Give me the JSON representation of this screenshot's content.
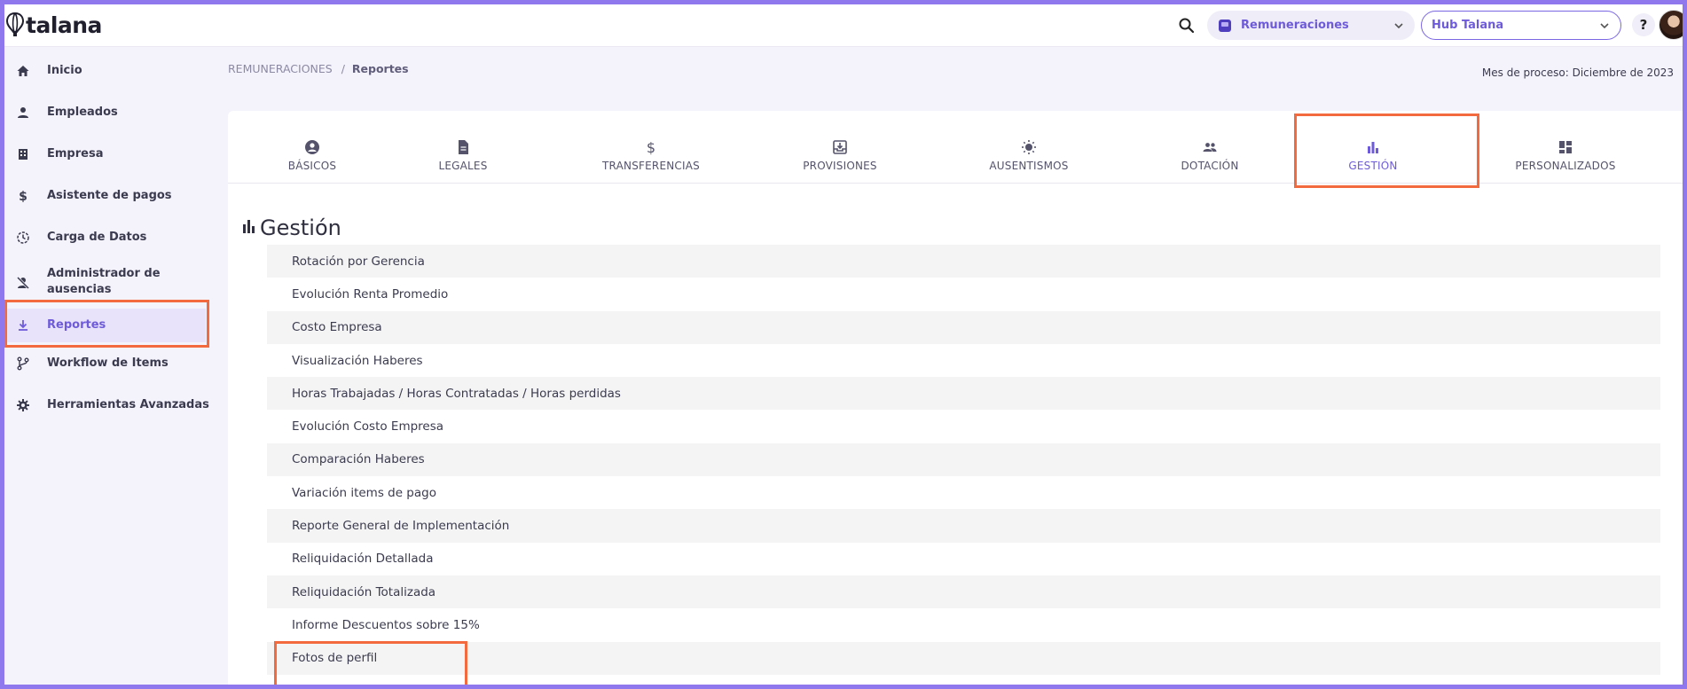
{
  "header": {
    "logo_text": "talana",
    "module_select": {
      "value": "Remuneraciones"
    },
    "hub_select": {
      "value": "Hub Talana"
    },
    "help_label": "?"
  },
  "sidebar": {
    "items": [
      {
        "label": "Inicio",
        "icon": "home-icon"
      },
      {
        "label": "Empleados",
        "icon": "person-icon"
      },
      {
        "label": "Empresa",
        "icon": "building-icon"
      },
      {
        "label": "Asistente de pagos",
        "icon": "dollar-icon"
      },
      {
        "label": "Carga de Datos",
        "icon": "upload-clock-icon"
      },
      {
        "label_line1": "Administrador de",
        "label_line2": "ausencias",
        "icon": "person-off-icon"
      },
      {
        "label": "Reportes",
        "icon": "download-icon",
        "active": true
      },
      {
        "label": "Workflow de Items",
        "icon": "branch-icon"
      },
      {
        "label": "Herramientas Avanzadas",
        "icon": "gear-icon"
      }
    ]
  },
  "breadcrumb": {
    "root": "REMUNERACIONES",
    "separator": "/",
    "current": "Reportes"
  },
  "process_month": "Mes de proceso: Diciembre de 2023",
  "tabs": [
    {
      "label": "BÁSICOS",
      "icon": "account-circle-icon"
    },
    {
      "label": "LEGALES",
      "icon": "document-icon"
    },
    {
      "label": "TRANSFERENCIAS",
      "icon": "dollar-icon"
    },
    {
      "label": "PROVISIONES",
      "icon": "tray-download-icon"
    },
    {
      "label": "AUSENTISMOS",
      "icon": "sun-icon"
    },
    {
      "label": "DOTACIÓN",
      "icon": "people-icon"
    },
    {
      "label": "GESTIÓN",
      "icon": "bar-chart-icon",
      "active": true
    },
    {
      "label": "PERSONALIZADOS",
      "icon": "dashboard-icon"
    }
  ],
  "section": {
    "title": "Gestión",
    "icon": "bar-chart-icon"
  },
  "reports": [
    "Rotación por Gerencia",
    "Evolución Renta Promedio",
    "Costo Empresa",
    "Visualización Haberes",
    "Horas Trabajadas / Horas Contratadas / Horas perdidas",
    "Evolución Costo Empresa",
    "Comparación Haberes",
    "Variación items de pago",
    "Reporte General de Implementación",
    "Reliquidación Detallada",
    "Reliquidación Totalizada",
    "Informe Descuentos sobre 15%",
    "Fotos de perfil"
  ],
  "colors": {
    "accent": "#6e5bd9",
    "highlight": "#f26a3d",
    "frame": "#8f77ee"
  }
}
